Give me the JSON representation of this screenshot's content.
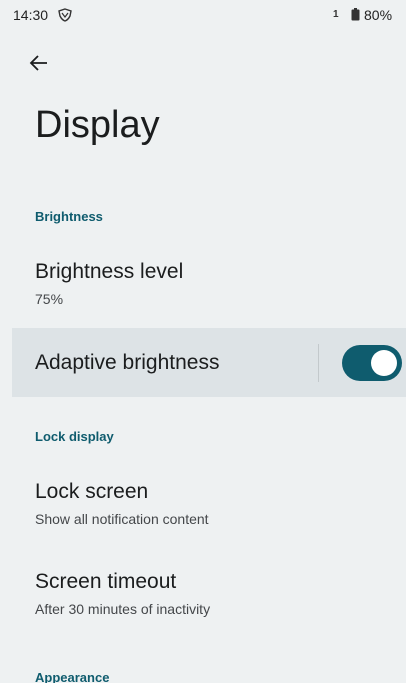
{
  "status_bar": {
    "time": "14:30",
    "vpn_icon": "shield-icon",
    "sim": "1",
    "battery": "80%"
  },
  "header": {
    "back_icon": "arrow-back-icon",
    "title": "Display"
  },
  "sections": {
    "brightness": {
      "header": "Brightness",
      "brightness_level": {
        "title": "Brightness level",
        "summary": "75%"
      },
      "adaptive": {
        "title": "Adaptive brightness",
        "enabled": true
      }
    },
    "lock_display": {
      "header": "Lock display",
      "lock_screen": {
        "title": "Lock screen",
        "summary": "Show all notification content"
      },
      "screen_timeout": {
        "title": "Screen timeout",
        "summary": "After 30 minutes of inactivity"
      }
    },
    "appearance": {
      "header": "Appearance"
    }
  },
  "colors": {
    "accent": "#0f5c6e",
    "background": "#eef1f2",
    "highlight": "#dde3e6"
  }
}
